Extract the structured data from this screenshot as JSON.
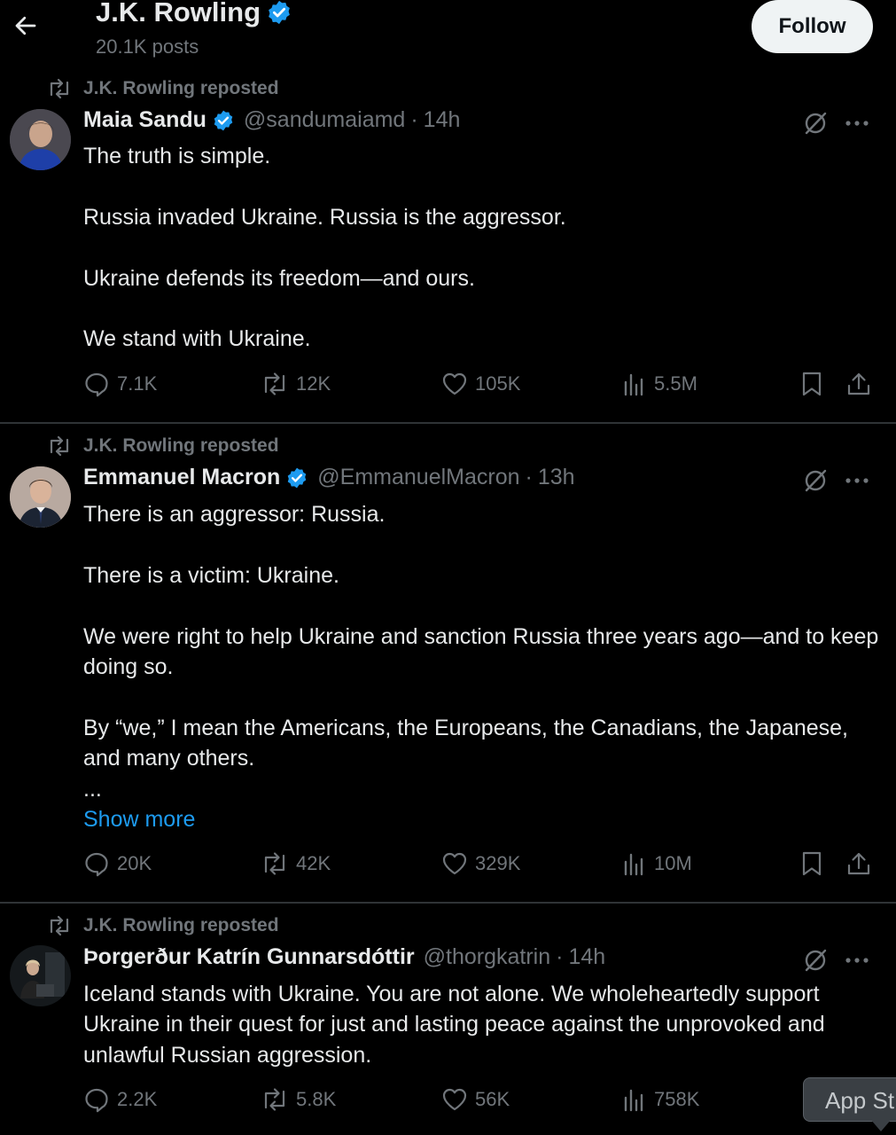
{
  "header": {
    "name": "J.K. Rowling",
    "posts_count": "20.1K posts",
    "follow_label": "Follow"
  },
  "posts": [
    {
      "repost_label": "J.K. Rowling reposted",
      "author": "Maia Sandu",
      "handle": "@sandumaiamd",
      "dot": "·",
      "time": "14h",
      "lines": [
        "The truth is simple.",
        "Russia invaded Ukraine. Russia is the aggressor.",
        "Ukraine defends its freedom—and ours.",
        "We stand with Ukraine."
      ],
      "replies": "7.1K",
      "reposts": "12K",
      "likes": "105K",
      "views": "5.5M"
    },
    {
      "repost_label": "J.K. Rowling reposted",
      "author": "Emmanuel Macron",
      "handle": "@EmmanuelMacron",
      "dot": "·",
      "time": "13h",
      "lines": [
        "There is an aggressor: Russia.",
        "There is a victim: Ukraine.",
        "We were right to help Ukraine and sanction Russia three years ago—and to keep doing so.",
        "By “we,” I mean the Americans, the Europeans, the Canadians, the Japanese, and many others.",
        "..."
      ],
      "show_more": "Show more",
      "replies": "20K",
      "reposts": "42K",
      "likes": "329K",
      "views": "10M"
    },
    {
      "repost_label": "J.K. Rowling reposted",
      "author": "Þorgerður Katrín Gunnarsdóttir",
      "handle": "@thorgkatrin",
      "dot": "·",
      "time": "14h",
      "lines": [
        "Iceland stands with Ukraine. You are not alone. We wholeheartedly support Ukraine in their quest for just and lasting peace against the unprovoked and unlawful Russian aggression."
      ],
      "replies": "2.2K",
      "reposts": "5.8K",
      "likes": "56K",
      "views": "758K"
    }
  ],
  "app_store_tooltip": "App St",
  "colors": {
    "background": "#000000",
    "text": "#e7e9ea",
    "secondary": "#71767b",
    "link": "#1d9bf0",
    "verified": "#1d9bf0",
    "divider": "#2f3336",
    "follow_bg": "#eff3f4"
  }
}
